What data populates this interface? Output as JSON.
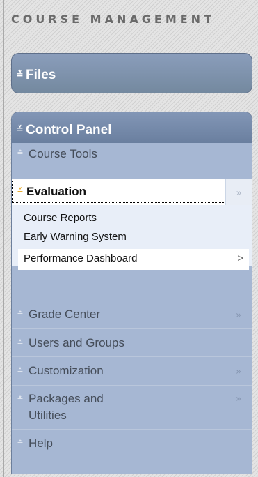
{
  "header": {
    "title": "COURSE MANAGEMENT"
  },
  "files": {
    "title": "Files",
    "icon": "chevron-double-down-icon"
  },
  "control_panel": {
    "title": "Control Panel",
    "icon": "chevron-double-up-icon",
    "items": [
      {
        "label": "Course Tools",
        "has_arrow": false
      },
      {
        "label": "Evaluation",
        "expanded": true,
        "has_arrow": true,
        "sub_items": [
          {
            "label": "Course Reports"
          },
          {
            "label": "Early Warning System"
          },
          {
            "label": "Performance Dashboard",
            "selected": true,
            "indicator": ">"
          }
        ]
      },
      {
        "label": "Grade Center",
        "has_arrow": true
      },
      {
        "label": "Users and Groups",
        "has_arrow": false
      },
      {
        "label": "Customization",
        "has_arrow": true
      },
      {
        "label": "Packages and",
        "label_line2": "Utilities",
        "has_arrow": true
      },
      {
        "label": "Help",
        "has_arrow": false
      }
    ]
  },
  "glyphs": {
    "collapsed_chevron": "»",
    "expanded_chevron": "«",
    "side_arrow": "»",
    "sub_arrow": ">"
  },
  "colors": {
    "panel_header": "#7a8eae",
    "panel_body": "#a6b7d3",
    "submenu_bg": "#e8eef8",
    "selected_bg": "#ffffff",
    "expanded_chevron": "#e5a218"
  }
}
